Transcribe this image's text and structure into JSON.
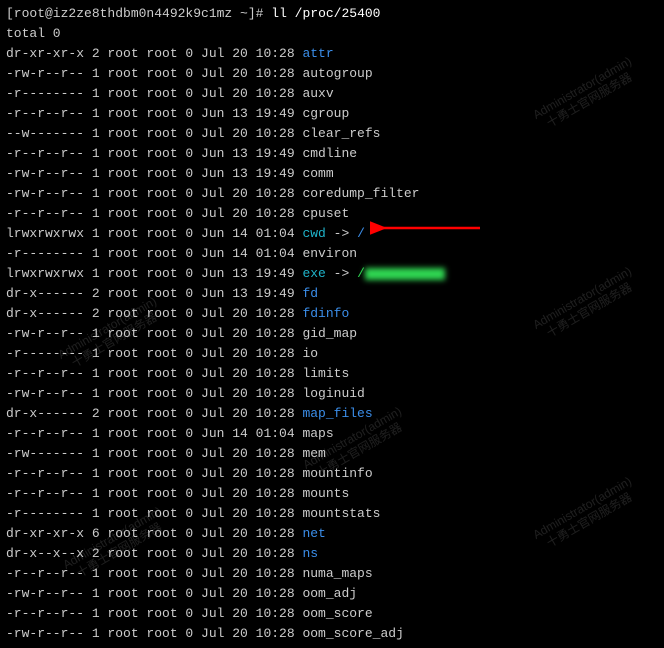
{
  "prompt": {
    "user_host": "[root@iz2ze8thdbm0n4492k9c1mz ~]#",
    "command": "ll /proc/25400"
  },
  "total_line": "total 0",
  "rows": [
    {
      "perm": "dr-xr-xr-x",
      "links": "2",
      "owner": "root",
      "group": "root",
      "size": "0",
      "date": "Jul 20 10:28",
      "name": "attr",
      "cls": "blue",
      "link": ""
    },
    {
      "perm": "-rw-r--r--",
      "links": "1",
      "owner": "root",
      "group": "root",
      "size": "0",
      "date": "Jul 20 10:28",
      "name": "autogroup",
      "cls": "dim",
      "link": ""
    },
    {
      "perm": "-r--------",
      "links": "1",
      "owner": "root",
      "group": "root",
      "size": "0",
      "date": "Jul 20 10:28",
      "name": "auxv",
      "cls": "dim",
      "link": ""
    },
    {
      "perm": "-r--r--r--",
      "links": "1",
      "owner": "root",
      "group": "root",
      "size": "0",
      "date": "Jun 13 19:49",
      "name": "cgroup",
      "cls": "dim",
      "link": ""
    },
    {
      "perm": "--w-------",
      "links": "1",
      "owner": "root",
      "group": "root",
      "size": "0",
      "date": "Jul 20 10:28",
      "name": "clear_refs",
      "cls": "dim",
      "link": ""
    },
    {
      "perm": "-r--r--r--",
      "links": "1",
      "owner": "root",
      "group": "root",
      "size": "0",
      "date": "Jun 13 19:49",
      "name": "cmdline",
      "cls": "dim",
      "link": ""
    },
    {
      "perm": "-rw-r--r--",
      "links": "1",
      "owner": "root",
      "group": "root",
      "size": "0",
      "date": "Jun 13 19:49",
      "name": "comm",
      "cls": "dim",
      "link": ""
    },
    {
      "perm": "-rw-r--r--",
      "links": "1",
      "owner": "root",
      "group": "root",
      "size": "0",
      "date": "Jul 20 10:28",
      "name": "coredump_filter",
      "cls": "dim",
      "link": ""
    },
    {
      "perm": "-r--r--r--",
      "links": "1",
      "owner": "root",
      "group": "root",
      "size": "0",
      "date": "Jul 20 10:28",
      "name": "cpuset",
      "cls": "dim",
      "link": ""
    },
    {
      "perm": "lrwxrwxrwx",
      "links": "1",
      "owner": "root",
      "group": "root",
      "size": "0",
      "date": "Jun 14 01:04",
      "name": "cwd",
      "cls": "cyan",
      "link": " -> ",
      "target": "/",
      "tcls": "blue"
    },
    {
      "perm": "-r--------",
      "links": "1",
      "owner": "root",
      "group": "root",
      "size": "0",
      "date": "Jun 14 01:04",
      "name": "environ",
      "cls": "dim",
      "link": ""
    },
    {
      "perm": "lrwxrwxrwx",
      "links": "1",
      "owner": "root",
      "group": "root",
      "size": "0",
      "date": "Jun 13 19:49",
      "name": "exe",
      "cls": "cyan",
      "link": " -> ",
      "target": "/",
      "tcls": "green",
      "blurred": true
    },
    {
      "perm": "dr-x------",
      "links": "2",
      "owner": "root",
      "group": "root",
      "size": "0",
      "date": "Jun 13 19:49",
      "name": "fd",
      "cls": "blue",
      "link": ""
    },
    {
      "perm": "dr-x------",
      "links": "2",
      "owner": "root",
      "group": "root",
      "size": "0",
      "date": "Jul 20 10:28",
      "name": "fdinfo",
      "cls": "blue",
      "link": ""
    },
    {
      "perm": "-rw-r--r--",
      "links": "1",
      "owner": "root",
      "group": "root",
      "size": "0",
      "date": "Jul 20 10:28",
      "name": "gid_map",
      "cls": "dim",
      "link": ""
    },
    {
      "perm": "-r--------",
      "links": "1",
      "owner": "root",
      "group": "root",
      "size": "0",
      "date": "Jul 20 10:28",
      "name": "io",
      "cls": "dim",
      "link": ""
    },
    {
      "perm": "-r--r--r--",
      "links": "1",
      "owner": "root",
      "group": "root",
      "size": "0",
      "date": "Jul 20 10:28",
      "name": "limits",
      "cls": "dim",
      "link": ""
    },
    {
      "perm": "-rw-r--r--",
      "links": "1",
      "owner": "root",
      "group": "root",
      "size": "0",
      "date": "Jul 20 10:28",
      "name": "loginuid",
      "cls": "dim",
      "link": ""
    },
    {
      "perm": "dr-x------",
      "links": "2",
      "owner": "root",
      "group": "root",
      "size": "0",
      "date": "Jul 20 10:28",
      "name": "map_files",
      "cls": "blue",
      "link": ""
    },
    {
      "perm": "-r--r--r--",
      "links": "1",
      "owner": "root",
      "group": "root",
      "size": "0",
      "date": "Jun 14 01:04",
      "name": "maps",
      "cls": "dim",
      "link": ""
    },
    {
      "perm": "-rw-------",
      "links": "1",
      "owner": "root",
      "group": "root",
      "size": "0",
      "date": "Jul 20 10:28",
      "name": "mem",
      "cls": "dim",
      "link": ""
    },
    {
      "perm": "-r--r--r--",
      "links": "1",
      "owner": "root",
      "group": "root",
      "size": "0",
      "date": "Jul 20 10:28",
      "name": "mountinfo",
      "cls": "dim",
      "link": ""
    },
    {
      "perm": "-r--r--r--",
      "links": "1",
      "owner": "root",
      "group": "root",
      "size": "0",
      "date": "Jul 20 10:28",
      "name": "mounts",
      "cls": "dim",
      "link": ""
    },
    {
      "perm": "-r--------",
      "links": "1",
      "owner": "root",
      "group": "root",
      "size": "0",
      "date": "Jul 20 10:28",
      "name": "mountstats",
      "cls": "dim",
      "link": ""
    },
    {
      "perm": "dr-xr-xr-x",
      "links": "6",
      "owner": "root",
      "group": "root",
      "size": "0",
      "date": "Jul 20 10:28",
      "name": "net",
      "cls": "blue",
      "link": ""
    },
    {
      "perm": "dr-x--x--x",
      "links": "2",
      "owner": "root",
      "group": "root",
      "size": "0",
      "date": "Jul 20 10:28",
      "name": "ns",
      "cls": "blue",
      "link": ""
    },
    {
      "perm": "-r--r--r--",
      "links": "1",
      "owner": "root",
      "group": "root",
      "size": "0",
      "date": "Jul 20 10:28",
      "name": "numa_maps",
      "cls": "dim",
      "link": ""
    },
    {
      "perm": "-rw-r--r--",
      "links": "1",
      "owner": "root",
      "group": "root",
      "size": "0",
      "date": "Jul 20 10:28",
      "name": "oom_adj",
      "cls": "dim",
      "link": ""
    },
    {
      "perm": "-r--r--r--",
      "links": "1",
      "owner": "root",
      "group": "root",
      "size": "0",
      "date": "Jul 20 10:28",
      "name": "oom_score",
      "cls": "dim",
      "link": ""
    },
    {
      "perm": "-rw-r--r--",
      "links": "1",
      "owner": "root",
      "group": "root",
      "size": "0",
      "date": "Jul 20 10:28",
      "name": "oom_score_adj",
      "cls": "dim",
      "link": ""
    }
  ],
  "watermark": {
    "line1": "Administrator(admin)",
    "line2": "十勇士官网服务器"
  }
}
